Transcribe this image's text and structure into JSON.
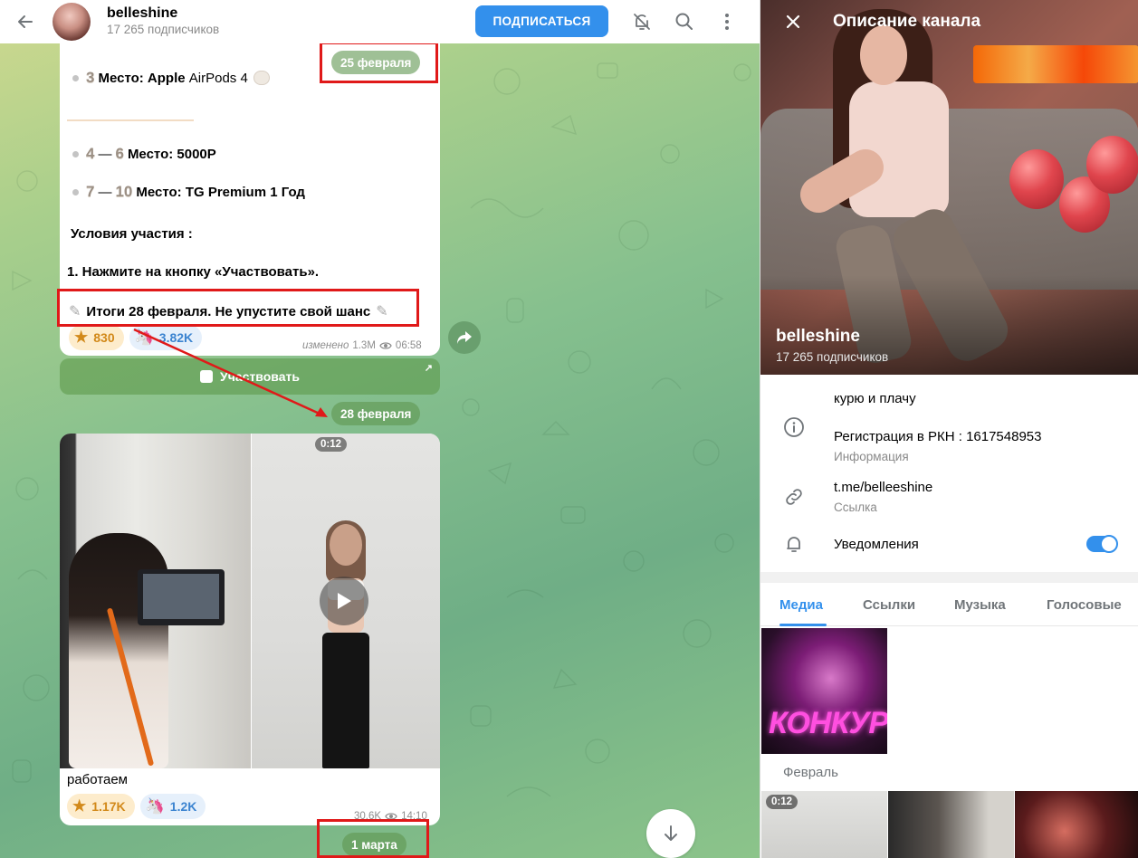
{
  "header": {
    "channel_name": "belleshine",
    "subscribers": "17 265 подписчиков",
    "subscribe_label": "ПОДПИСАТЬСЯ"
  },
  "giveaway_post": {
    "line_airpods_prefix": "Место: Apple",
    "line_airpods_product": "AirPods 4",
    "line_4_6": "Место: 5000Р",
    "line_7_10": "Место: TG Premium 1 Год",
    "conditions_title": "Условия участия :",
    "condition_1": "1. Нажмите на кнопку «Участвовать».",
    "results_line": "Итоги 28 февраля. Не упустите свой шанс",
    "reaction_star_count": "830",
    "reaction_unicorn_count": "3.82K",
    "edited_label": "изменено",
    "views": "1.3M",
    "time": "06:58",
    "participate_button": "Участвовать"
  },
  "dates": {
    "feb25": "25 февраля",
    "feb28": "28 февраля",
    "mar1": "1 марта"
  },
  "video_post": {
    "duration": "0:12",
    "caption": "работаем",
    "reaction_star_count": "1.17K",
    "reaction_unicorn_count": "1.2K",
    "views": "30.6K",
    "time": "14:10"
  },
  "panel": {
    "title": "Описание канала",
    "name": "belleshine",
    "subscribers": "17 265 подписчиков",
    "description_line1": "курю и плачу",
    "description_line2": "Регистрация в РКН : 1617548953",
    "description_label": "Информация",
    "link": "t.me/belleeshine",
    "link_label": "Ссылка",
    "notifications_label": "Уведомления",
    "notifications_on": true,
    "tabs": [
      "Медиа",
      "Ссылки",
      "Музыка",
      "Голосовые"
    ],
    "month": "Февраль",
    "tile_konkurs_text": "КОНКУРС",
    "tile_duration": "0:12"
  },
  "colors": {
    "accent": "#3390ec",
    "annotation_red": "#e01919"
  }
}
